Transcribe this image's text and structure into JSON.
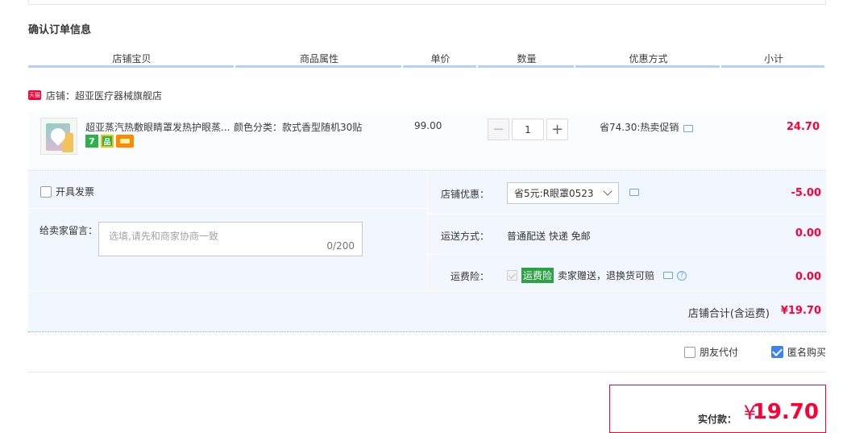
{
  "section_title": "确认订单信息",
  "columns": [
    "店铺宝贝",
    "商品属性",
    "单价",
    "数量",
    "优惠方式",
    "小计"
  ],
  "shop": {
    "badge": "天猫",
    "label": "店铺：超亚医疗器械旗舰店"
  },
  "item": {
    "name": "超亚蒸汽热敷眼睛罩发热护眼蒸...",
    "attribute": "颜色分类：款式香型随机30贴",
    "unit_price": "99.00",
    "quantity": "1",
    "promo": "省74.30:热卖促销",
    "subtotal": "24.70"
  },
  "invoice_label": "开具发票",
  "memo": {
    "label": "给卖家留言：",
    "placeholder": "选填,请先和商家协商一致",
    "counter": "0/200"
  },
  "shop_discount": {
    "label": "店铺优惠：",
    "selected": "省5元:R眼罩0523",
    "value": "-5.00"
  },
  "shipping": {
    "label": "运送方式：",
    "text": "普通配送 快递 免邮",
    "value": "0.00"
  },
  "insurance": {
    "label": "运费险：",
    "badge": "运费险",
    "text": "卖家赠送，退换货可赔",
    "value": "0.00"
  },
  "shop_total": {
    "label": "店铺合计(含运费)",
    "value": "¥19.70"
  },
  "friend_pay_label": "朋友代付",
  "anonymous_label": "匿名购买",
  "payment": {
    "label": "实付款：",
    "symbol": "¥",
    "value": "19.70"
  },
  "colors": {
    "accent": "#ff0036",
    "panel": "#f2f7ff",
    "header_bar": "#b2d1ff",
    "check": "#3d82f5"
  }
}
